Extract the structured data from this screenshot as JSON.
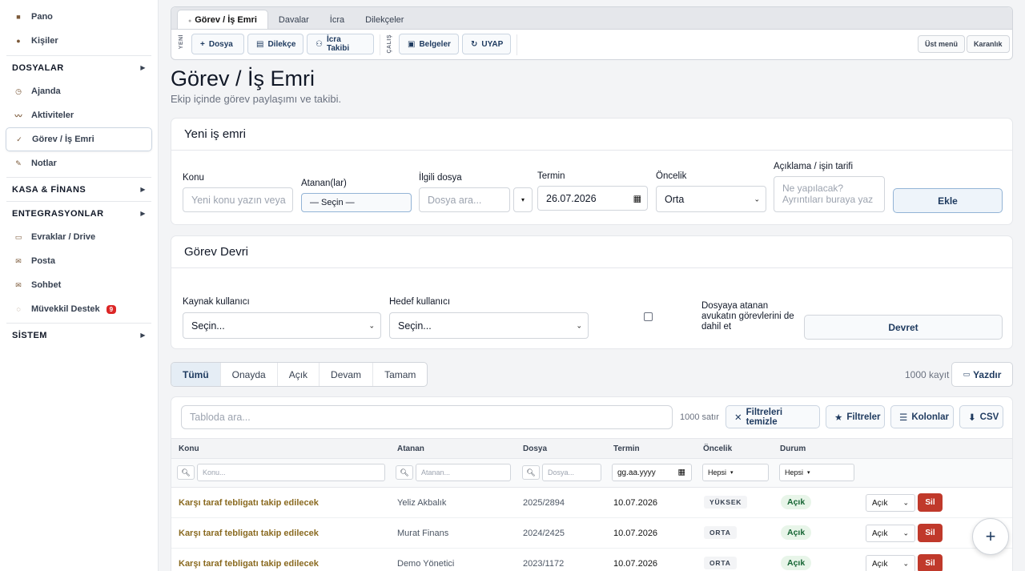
{
  "sidebar": {
    "top_items": [
      {
        "label": "Pano",
        "icon": "dashboard-icon"
      },
      {
        "label": "Kişiler",
        "icon": "people-icon"
      }
    ],
    "sections": [
      {
        "title": "DOSYALAR",
        "items": [
          {
            "label": "Ajanda",
            "icon": "clock-icon"
          },
          {
            "label": "Aktiviteler",
            "icon": "activity-icon"
          },
          {
            "label": "Görev / İş Emri",
            "icon": "check-icon",
            "active": true
          },
          {
            "label": "Notlar",
            "icon": "pencil-icon"
          }
        ]
      },
      {
        "title": "KASA & FİNANS",
        "items": []
      },
      {
        "title": "ENTEGRASYONLAR",
        "items": [
          {
            "label": "Evraklar / Drive",
            "icon": "folder-icon"
          },
          {
            "label": "Posta",
            "icon": "mail-icon"
          },
          {
            "label": "Sohbet",
            "icon": "chat-icon"
          },
          {
            "label": "Müvekkil Destek",
            "icon": "support-icon",
            "badge": "9"
          }
        ]
      },
      {
        "title": "SİSTEM",
        "items": []
      }
    ]
  },
  "topbar": {
    "tabs": [
      "Görev / İş Emri",
      "Davalar",
      "İcra",
      "Dilekçeler"
    ],
    "group_labels": [
      "YENİ",
      "ÇALIŞ"
    ],
    "new_buttons": [
      "Dosya",
      "Dilekçe",
      "İcra Takibi"
    ],
    "work_buttons": [
      "Belgeler",
      "UYAP"
    ],
    "right_buttons": [
      "Üst menü",
      "Karanlık"
    ]
  },
  "page": {
    "title": "Görev / İş Emri",
    "subtitle": "Ekip içinde görev paylaşımı ve takibi."
  },
  "new_task": {
    "heading": "Yeni iş emri",
    "subject_label": "Konu",
    "subject_placeholder": "Yeni konu yazın veya",
    "assignee_label": "Atanan(lar)",
    "assignee_value": "— Seçin —",
    "file_label": "İlgili dosya",
    "file_placeholder": "Dosya ara...",
    "due_label": "Termin",
    "due_value": "26.07.2026",
    "priority_label": "Öncelik",
    "priority_value": "Orta",
    "desc_label": "Açıklama / işin tarifi",
    "desc_placeholder": "Ne yapılacak? Ayrıntıları buraya yaz",
    "add_button": "Ekle"
  },
  "transfer": {
    "heading": "Görev Devri",
    "source_label": "Kaynak kullanıcı",
    "source_value": "Seçin...",
    "target_label": "Hedef kullanıcı",
    "target_value": "Seçin...",
    "include_label": "Dosyaya atanan avukatın görevlerini de dahil et",
    "transfer_button": "Devret"
  },
  "filters": {
    "tabs": [
      "Tümü",
      "Onayda",
      "Açık",
      "Devam",
      "Tamam"
    ],
    "active_tab": "Tümü",
    "record_count": "1000 kayıt",
    "print_button": "Yazdır"
  },
  "table": {
    "search_placeholder": "Tabloda ara...",
    "row_count": "1000 satır",
    "clear_filters": "Filtreleri temizle",
    "filters_button": "Filtreler",
    "columns_button": "Kolonlar",
    "csv_button": "CSV",
    "headers": [
      "Konu",
      "Atanan",
      "Dosya",
      "Termin",
      "Öncelik",
      "Durum"
    ],
    "filter_placeholders": [
      "Konu...",
      "Atanan...",
      "Dosya...",
      "gg.aa.yyyy",
      "Hepsi",
      "Hepsi"
    ],
    "rows": [
      {
        "konu": "Karşı taraf tebligatı takip edilecek",
        "atanan": "Yeliz Akbalık",
        "dosya": "2025/2894",
        "termin": "10.07.2026",
        "oncelik": "YÜKSEK",
        "durum": "Açık",
        "select": "Açık",
        "delete": "Sil"
      },
      {
        "konu": "Karşı taraf tebligatı takip edilecek",
        "atanan": "Murat Finans",
        "dosya": "2024/2425",
        "termin": "10.07.2026",
        "oncelik": "ORTA",
        "durum": "Açık",
        "select": "Açık",
        "delete": "Sil"
      },
      {
        "konu": "Karşı taraf tebligatı takip edilecek",
        "atanan": "Demo Yönetici",
        "dosya": "2023/1172",
        "termin": "10.07.2026",
        "oncelik": "ORTA",
        "durum": "Açık",
        "select": "Açık",
        "delete": "Sil"
      }
    ]
  },
  "fab": "+"
}
